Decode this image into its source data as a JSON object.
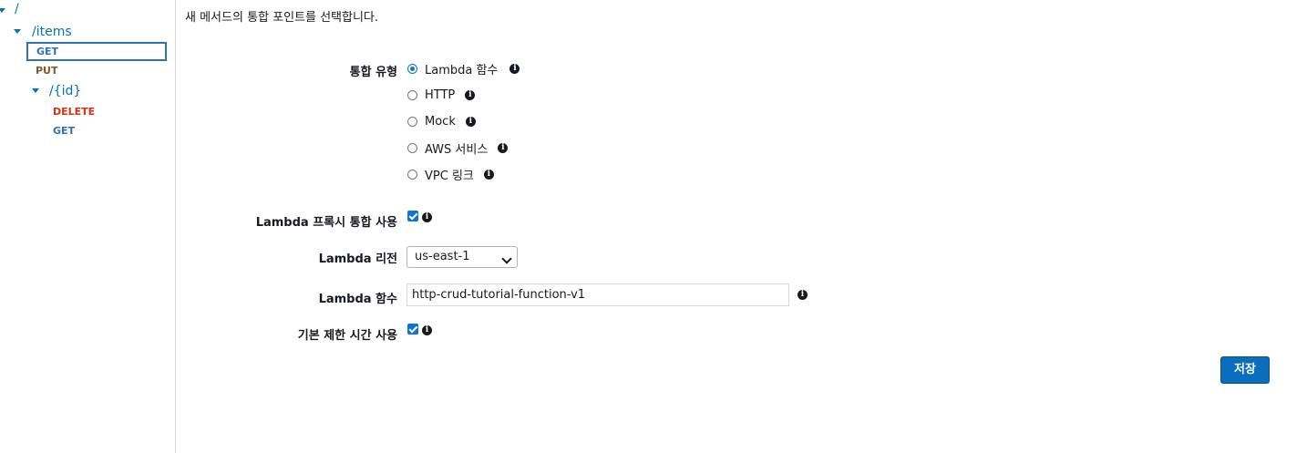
{
  "sidebar": {
    "root_path": "/",
    "items_path": "/items",
    "items_get": "GET",
    "items_put": "PUT",
    "id_path": "/{id}",
    "id_delete": "DELETE",
    "id_get": "GET"
  },
  "main": {
    "intro": "새 메서드의 통합 포인트를 선택합니다.",
    "integration_type_label": "통합 유형",
    "integration_options": [
      {
        "label": "Lambda 함수",
        "selected": true
      },
      {
        "label": "HTTP",
        "selected": false
      },
      {
        "label": "Mock",
        "selected": false
      },
      {
        "label": "AWS 서비스",
        "selected": false
      },
      {
        "label": "VPC 링크",
        "selected": false
      }
    ],
    "proxy_label": "Lambda 프록시 통합 사용",
    "proxy_checked": true,
    "region_label": "Lambda 리전",
    "region_value": "us-east-1",
    "function_label": "Lambda 함수",
    "function_value": "http-crud-tutorial-function-v1",
    "timeout_label": "기본 제한 시간 사용",
    "timeout_checked": true,
    "save_label": "저장"
  },
  "colors": {
    "link": "#0073bb",
    "get": "#2e73b8",
    "put": "#7f5a2b",
    "delete": "#d13212",
    "primary_button": "#0a6ebd"
  },
  "icons": {
    "info": "info-icon",
    "caret": "caret-down-icon"
  }
}
